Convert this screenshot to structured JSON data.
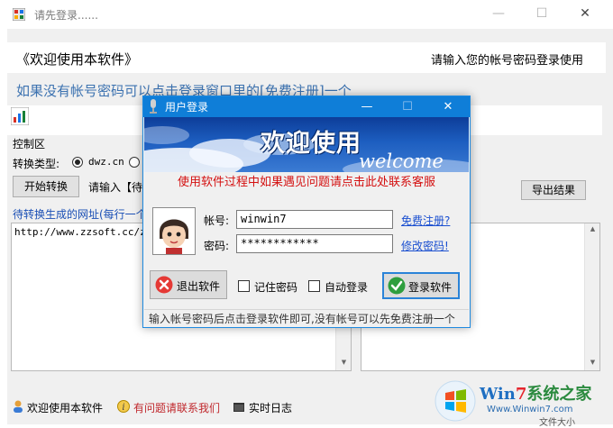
{
  "main_window": {
    "title": "请先登录......",
    "welcome_left": "《欢迎使用本软件》",
    "welcome_right": "请输入您的帐号密码登录使用",
    "notice": "如果没有帐号密码可以点击登录窗口里的[免费注册]一个",
    "control_section": "控制区",
    "convert_type_label": "转换类型:",
    "radio_dwz": "dwz.cn",
    "start_button": "开始转换",
    "input_hint": "请输入【待",
    "export_button": "导出结果",
    "list_title": "待转换生成的网址(每行一个",
    "list_content": "http://www.zzsoft.cc/zzs"
  },
  "statusbar": {
    "welcome": "欢迎使用本软件",
    "contact": "有问题请联系我们",
    "log": "实时日志"
  },
  "dialog": {
    "title": "用户登录",
    "banner_title": "欢迎使用",
    "banner_sub": "welcome",
    "help_text": "使用软件过程中如果遇见问题请点击此处联系客服",
    "account_label": "帐号:",
    "account_value": "winwin7",
    "password_label": "密码:",
    "password_value": "************",
    "register_link": "免费注册?",
    "change_password_link": "修改密码!",
    "exit_button": "退出软件",
    "remember_password": "记住密码",
    "auto_login": "自动登录",
    "login_button": "登录软件",
    "status_text": "输入帐号密码后点击登录软件即可,没有帐号可以先免费注册一个"
  },
  "watermark": {
    "brand_prefix": "Win",
    "brand_digit": "7",
    "brand_suffix": "系统之家",
    "url": "Www.Winwin7.com",
    "corner_text": "文件大小"
  },
  "colors": {
    "dialog_titlebar": "#0f7ed8",
    "notice_text": "#3c72b0",
    "help_text": "#d41010",
    "link": "#1a4fd0"
  }
}
